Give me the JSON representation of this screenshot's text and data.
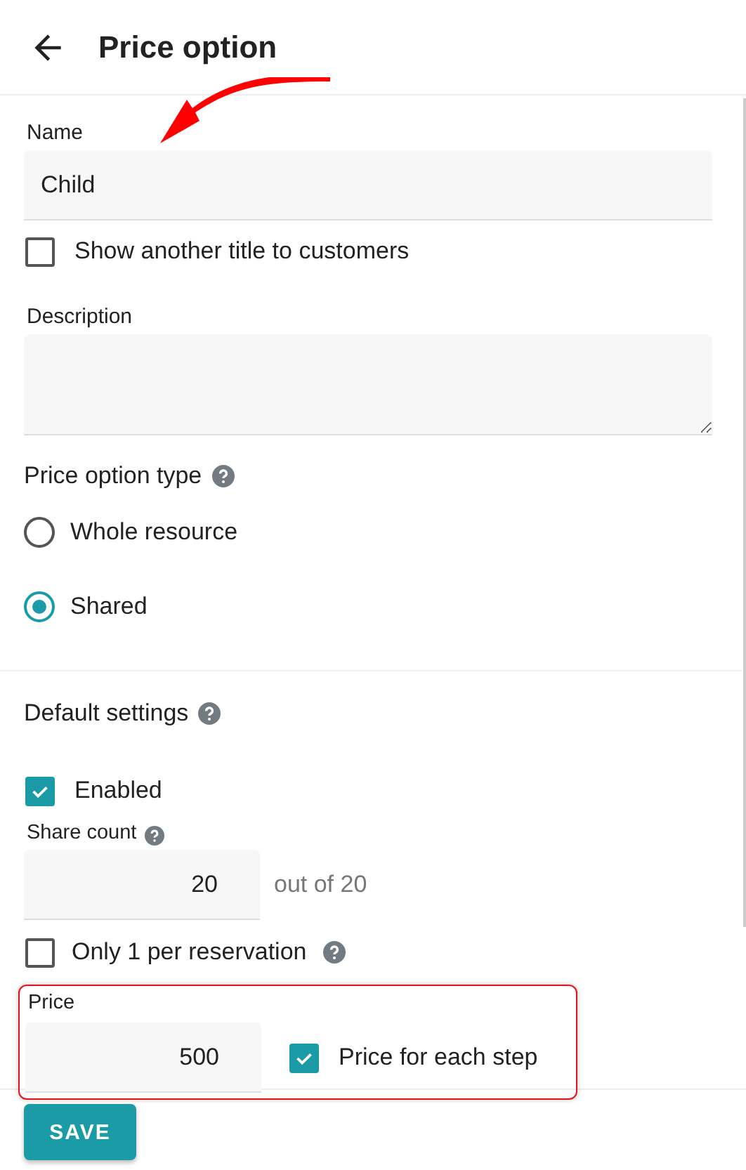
{
  "header": {
    "title": "Price option"
  },
  "name_field": {
    "label": "Name",
    "value": "Child"
  },
  "show_title": {
    "label": "Show another title to customers",
    "checked": false
  },
  "description_field": {
    "label": "Description"
  },
  "price_option_type": {
    "title": "Price option type",
    "options": [
      {
        "label": "Whole resource",
        "selected": false
      },
      {
        "label": "Shared",
        "selected": true
      }
    ]
  },
  "default_settings": {
    "title": "Default settings",
    "enabled": {
      "label": "Enabled",
      "checked": true
    },
    "share_count": {
      "label": "Share count",
      "value": "20",
      "suffix": "out of 20"
    },
    "only_one": {
      "label": "Only 1 per reservation",
      "checked": false
    },
    "price": {
      "label": "Price",
      "value": "500"
    },
    "price_each_step": {
      "label": "Price for each step",
      "checked": true
    }
  },
  "save_button": {
    "label": "SAVE"
  }
}
